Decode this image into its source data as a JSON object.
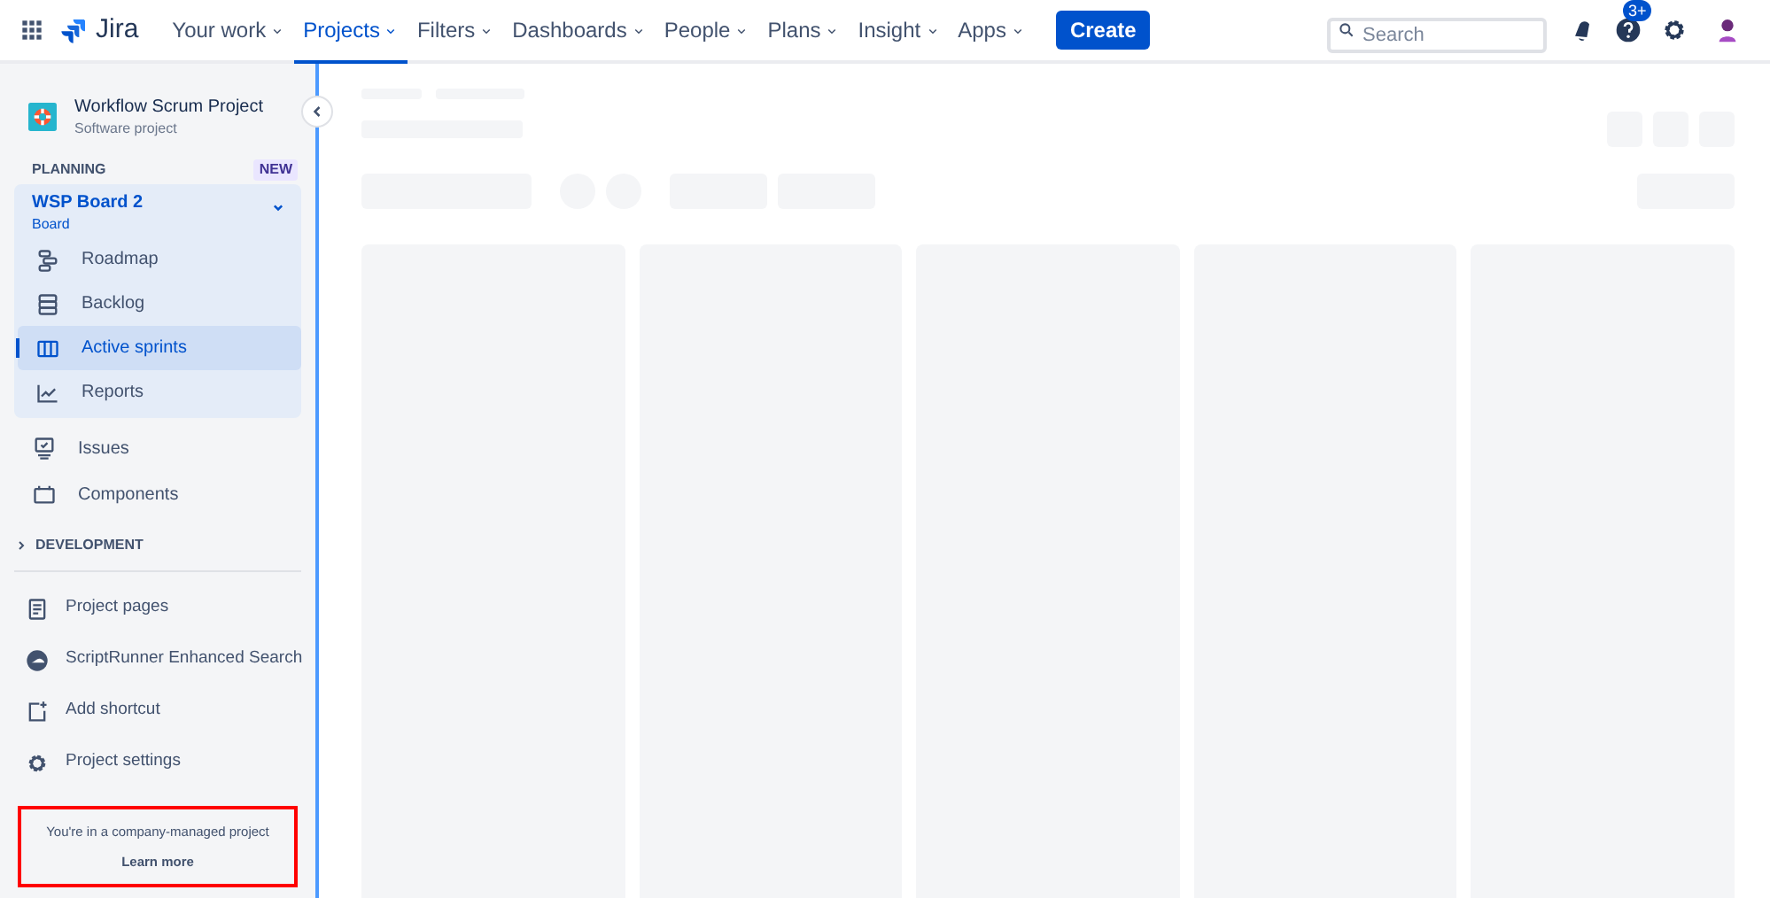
{
  "topbar": {
    "product": "Jira",
    "menu": [
      {
        "label": "Your work",
        "selected": false
      },
      {
        "label": "Projects",
        "selected": true
      },
      {
        "label": "Filters",
        "selected": false
      },
      {
        "label": "Dashboards",
        "selected": false
      },
      {
        "label": "People",
        "selected": false
      },
      {
        "label": "Plans",
        "selected": false
      },
      {
        "label": "Insight",
        "selected": false
      },
      {
        "label": "Apps",
        "selected": false
      }
    ],
    "create_button": "Create",
    "search": {
      "placeholder": "Search"
    },
    "help_badge": "3+"
  },
  "sidebar": {
    "project": {
      "name": "Workflow Scrum Project",
      "type": "Software project"
    },
    "planning": {
      "heading": "PLANNING",
      "badge": "NEW",
      "board": {
        "name": "WSP Board 2",
        "type": "Board",
        "expanded": true
      },
      "items": [
        {
          "label": "Roadmap",
          "selected": false
        },
        {
          "label": "Backlog",
          "selected": false
        },
        {
          "label": "Active sprints",
          "selected": true
        },
        {
          "label": "Reports",
          "selected": false
        }
      ]
    },
    "items": [
      {
        "label": "Issues"
      },
      {
        "label": "Components"
      }
    ],
    "development": {
      "heading": "DEVELOPMENT",
      "expanded": false
    },
    "links": [
      {
        "label": "Project pages"
      },
      {
        "label": "ScriptRunner Enhanced Search"
      },
      {
        "label": "Add shortcut"
      },
      {
        "label": "Project settings"
      }
    ],
    "footer": {
      "text": "You're in a company-managed project",
      "link": "Learn more",
      "highlighted": true
    }
  }
}
